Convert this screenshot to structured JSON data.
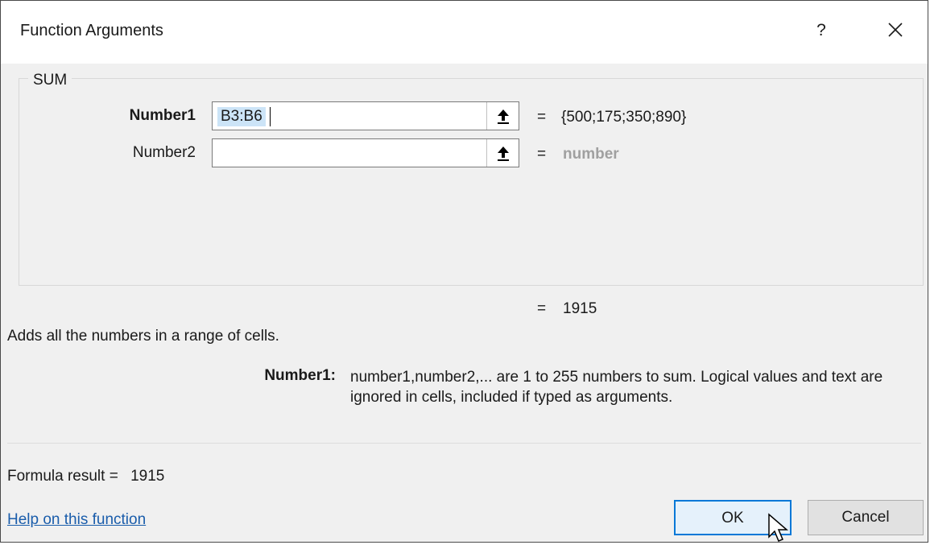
{
  "window": {
    "title": "Function Arguments",
    "help_label": "?",
    "close_icon": "close-icon"
  },
  "function": {
    "name": "SUM",
    "arguments": [
      {
        "label": "Number1",
        "value": "B3:B6",
        "result": "{500;175;350;890}",
        "active": true
      },
      {
        "label": "Number2",
        "value": "",
        "result": "number",
        "active": false
      }
    ],
    "equals": "="
  },
  "result": {
    "equals": "=",
    "value": "1915"
  },
  "description": "Adds all the numbers in a range of cells.",
  "argument_help": {
    "label": "Number1:",
    "text": "number1,number2,... are 1 to 255 numbers to sum. Logical values and text are ignored in cells, included if typed as arguments."
  },
  "formula_result": {
    "label": "Formula result =",
    "value": "1915"
  },
  "footer": {
    "help_link": "Help on this function",
    "ok_label": "OK",
    "cancel_label": "Cancel"
  },
  "colors": {
    "link": "#1a5dab",
    "ok_border": "#0078d7",
    "selection": "#cce4f7"
  }
}
